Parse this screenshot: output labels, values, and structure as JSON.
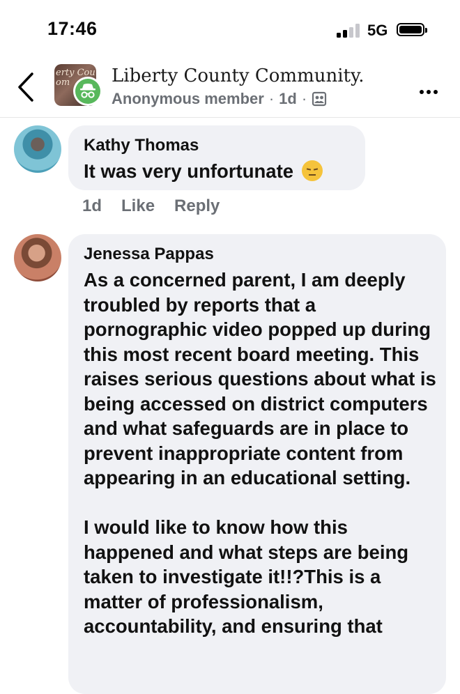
{
  "status_bar": {
    "time": "17:46",
    "network": "5G"
  },
  "header": {
    "group_name": "Liberty County Community.",
    "group_pic_text": "erty Cou\nom",
    "author": "Anonymous member",
    "separator": "·",
    "age": "1d",
    "separator2": "·"
  },
  "comments": [
    {
      "author": "Kathy Thomas",
      "text": "It was very unfortunate",
      "emoji": "pensive-face",
      "age": "1d",
      "like_label": "Like",
      "reply_label": "Reply"
    },
    {
      "author": "Jenessa Pappas",
      "paragraphs": [
        "As a concerned parent, I am deeply troubled by reports that a pornographic video popped up during this most recent board meeting. This raises serious questions about what is being accessed on district computers and what safeguards are in place to prevent inappropriate content from appearing in an educational setting.",
        "I would like to know how this happened and what steps are being taken to investigate it!!?This is a matter of professionalism, accountability, and ensuring that"
      ]
    }
  ],
  "colors": {
    "bubble": "#f0f1f5",
    "meta": "#6b6f75",
    "anon_badge": "#58b85c"
  }
}
